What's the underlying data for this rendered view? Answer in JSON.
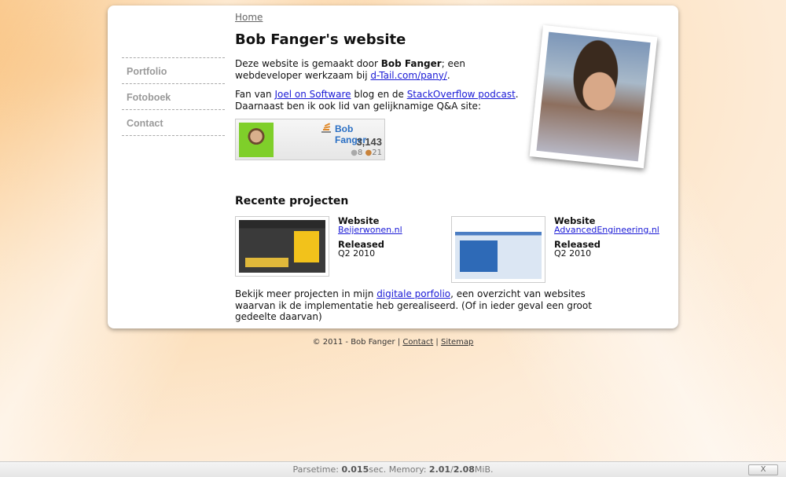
{
  "breadcrumb": {
    "home": "Home"
  },
  "nav": {
    "items": [
      "Portfolio",
      "Fotoboek",
      "Contact"
    ]
  },
  "page": {
    "title": "Bob Fanger's website",
    "intro": {
      "pre": "Deze website is gemaakt door ",
      "name": "Bob Fanger",
      "mid": "; een webdeveloper werkzaam bij ",
      "link": "d-Tail.com/pany/",
      "post": "."
    },
    "fan": {
      "pre": "Fan van ",
      "link1": "Joel on Software",
      "mid": " blog en de ",
      "link2": "StackOverflow podcast",
      "post": ". Daarnaast ben ik ook lid van gelijknamige Q&A site:"
    }
  },
  "so_flair": {
    "logo_icon": "stack-icon",
    "name": "Bob Fanger",
    "reputation": "3,143",
    "silver": "8",
    "bronze": "21",
    "dot": "●"
  },
  "projects": {
    "heading": "Recente projecten",
    "items": [
      {
        "website_label": "Website",
        "website": "Beijerwonen.nl",
        "released_label": "Released",
        "released": "Q2 2010"
      },
      {
        "website_label": "Website",
        "website": "AdvancedEngineering.nl",
        "released_label": "Released",
        "released": "Q2 2010"
      }
    ],
    "more": {
      "pre": "Bekijk meer projecten in mijn ",
      "link": "digitale porfolio",
      "post": ", een overzicht van websites waarvan ik de implementatie heb gerealiseerd. (Of in ieder geval een groot gedeelte daarvan)"
    }
  },
  "footer": {
    "copyright": "© 2011 - Bob Fanger | ",
    "contact": "Contact",
    "sep": " | ",
    "sitemap": "Sitemap"
  },
  "debug": {
    "parsetime_label": "Parsetime: ",
    "parsetime": "0.015",
    "parsetime_unit": "sec. ",
    "memory_label": "Memory: ",
    "memory_used": "2.01",
    "memory_sep": "/",
    "memory_total": "2.08",
    "memory_unit": "MiB.",
    "close": "X"
  },
  "colors": {
    "link": "#1a1ad6",
    "nav": "#9a9a9a",
    "so_name": "#2a6fc4"
  }
}
